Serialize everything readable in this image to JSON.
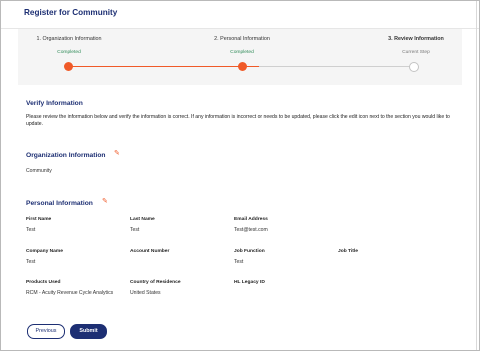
{
  "page": {
    "title": "Register for Community"
  },
  "steps": [
    {
      "label": "1. Organization Information",
      "status": "Completed"
    },
    {
      "label": "2. Personal Information",
      "status": "Completed"
    },
    {
      "label": "3. Review Information",
      "status": "Current Step"
    }
  ],
  "verify": {
    "title": "Verify Information",
    "description": "Please review the information below and verify the information is correct. If any information is incorrect or needs to be updated, please click the edit icon next to the section you would like to update."
  },
  "organization": {
    "title": "Organization Information",
    "value": "Community",
    "edit_icon": "pencil-icon"
  },
  "personal": {
    "title": "Personal Information",
    "edit_icon": "pencil-icon",
    "fields": {
      "first_name": {
        "label": "First Name",
        "value": "Test"
      },
      "last_name": {
        "label": "Last Name",
        "value": "Test"
      },
      "email": {
        "label": "Email Address",
        "value": "Test@test.com"
      },
      "company": {
        "label": "Company Name",
        "value": "Test"
      },
      "account": {
        "label": "Account Number",
        "value": ""
      },
      "job_function": {
        "label": "Job Function",
        "value": "Test"
      },
      "job_title": {
        "label": "Job Title",
        "value": ""
      },
      "products": {
        "label": "Products Used",
        "value": "RCM - Acuity Revenue Cycle Analytics"
      },
      "country": {
        "label": "Country of Residence",
        "value": "United States"
      },
      "hl_legacy": {
        "label": "HL Legacy ID",
        "value": ""
      }
    }
  },
  "buttons": {
    "previous": "Previous",
    "submit": "Submit"
  },
  "colors": {
    "brand": "#1d2f73",
    "accent": "#f05a28",
    "success": "#2e8b57"
  }
}
